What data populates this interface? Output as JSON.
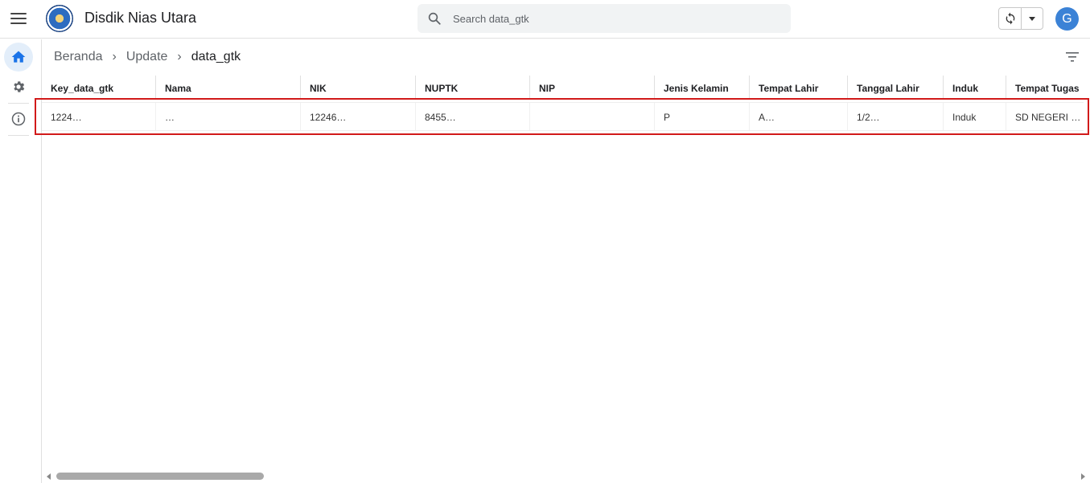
{
  "app": {
    "title": "Disdik Nias Utara"
  },
  "search": {
    "placeholder": "Search data_gtk"
  },
  "user": {
    "avatar_letter": "G"
  },
  "breadcrumb": {
    "items": [
      "Beranda",
      "Update",
      "data_gtk"
    ]
  },
  "table": {
    "columns": [
      "Key_data_gtk",
      "Nama",
      "NIK",
      "NUPTK",
      "NIP",
      "Jenis Kelamin",
      "Tempat Lahir",
      "Tanggal Lahir",
      "Induk",
      "Tempat Tugas"
    ],
    "rows": [
      [
        "1224…",
        "…",
        "12246…",
        "8455…",
        "",
        "P",
        "A…",
        "1/2…",
        "Induk",
        "SD NEGERI …"
      ]
    ]
  },
  "colors": {
    "accent": "#1a73e8",
    "highlight": "#d11a1a",
    "avatar": "#3b82d6"
  },
  "icons": [
    "menu-icon",
    "logo",
    "search-icon",
    "sync-icon",
    "chevron-down-icon",
    "home-icon",
    "gear-icon",
    "info-icon",
    "filter-icon"
  ]
}
